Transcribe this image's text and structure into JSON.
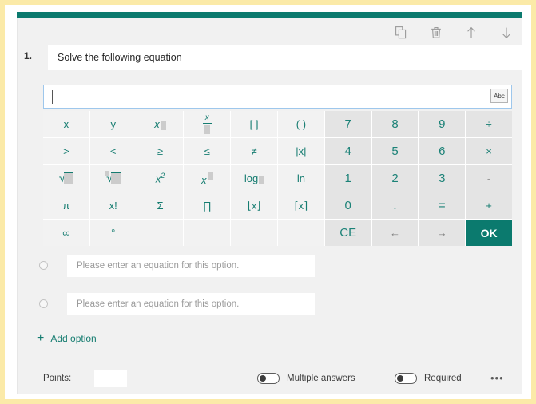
{
  "theme": {
    "accent": "#0b7a6e",
    "key_text": "#157c70",
    "outer_border": "#fbeaa8",
    "card_bg": "#f1f1f1",
    "num_key_bg": "#e4e4e4"
  },
  "toolbar": {
    "items": [
      {
        "name": "copy-icon",
        "title": "Copy question"
      },
      {
        "name": "delete-icon",
        "title": "Delete question"
      },
      {
        "name": "move-up-icon",
        "title": "Move up"
      },
      {
        "name": "move-down-icon",
        "title": "Move down"
      }
    ]
  },
  "question": {
    "number": "1.",
    "title": "Solve the following equation"
  },
  "equation_input": {
    "value": "",
    "abc_button": "Abc"
  },
  "keypad": {
    "rows": [
      [
        {
          "label": "x",
          "type": "sym"
        },
        {
          "label": "y",
          "type": "sym"
        },
        {
          "label": "x_",
          "type": "subscript"
        },
        {
          "label": "x/_",
          "type": "fraction"
        },
        {
          "label": "[ ]",
          "type": "sym"
        },
        {
          "label": "( )",
          "type": "sym"
        },
        {
          "label": "7",
          "type": "num"
        },
        {
          "label": "8",
          "type": "num"
        },
        {
          "label": "9",
          "type": "num"
        },
        {
          "label": "÷",
          "type": "op"
        }
      ],
      [
        {
          "label": ">",
          "type": "sym"
        },
        {
          "label": "<",
          "type": "sym"
        },
        {
          "label": "≥",
          "type": "sym"
        },
        {
          "label": "≤",
          "type": "sym"
        },
        {
          "label": "≠",
          "type": "sym"
        },
        {
          "label": "|x|",
          "type": "sym"
        },
        {
          "label": "4",
          "type": "num"
        },
        {
          "label": "5",
          "type": "num"
        },
        {
          "label": "6",
          "type": "num"
        },
        {
          "label": "×",
          "type": "op"
        }
      ],
      [
        {
          "label": "√",
          "type": "sqrt"
        },
        {
          "label": "ⁿ√",
          "type": "nthroot"
        },
        {
          "label": "x²",
          "type": "square"
        },
        {
          "label": "x^",
          "type": "power"
        },
        {
          "label": "log",
          "type": "log"
        },
        {
          "label": "ln",
          "type": "sym"
        },
        {
          "label": "1",
          "type": "num"
        },
        {
          "label": "2",
          "type": "num"
        },
        {
          "label": "3",
          "type": "num"
        },
        {
          "label": "-",
          "type": "op"
        }
      ],
      [
        {
          "label": "π",
          "type": "sym"
        },
        {
          "label": "x!",
          "type": "sym"
        },
        {
          "label": "Σ",
          "type": "sym"
        },
        {
          "label": "∏",
          "type": "sym"
        },
        {
          "label": "⌊x⌋",
          "type": "sym"
        },
        {
          "label": "⌈x⌉",
          "type": "sym"
        },
        {
          "label": "0",
          "type": "num"
        },
        {
          "label": ".",
          "type": "num"
        },
        {
          "label": "=",
          "type": "num"
        },
        {
          "label": "+",
          "type": "op"
        }
      ],
      [
        {
          "label": "∞",
          "type": "sym"
        },
        {
          "label": "°",
          "type": "sym"
        },
        {
          "label": "",
          "type": "blank"
        },
        {
          "label": "",
          "type": "blank"
        },
        {
          "label": "",
          "type": "blank"
        },
        {
          "label": "",
          "type": "blank"
        },
        {
          "label": "CE",
          "type": "num"
        },
        {
          "label": "←",
          "type": "arrow"
        },
        {
          "label": "→",
          "type": "arrow"
        },
        {
          "label": "OK",
          "type": "ok"
        }
      ]
    ]
  },
  "options": [
    {
      "placeholder": "Please enter an equation for this option.",
      "value": "",
      "selected": false
    },
    {
      "placeholder": "Please enter an equation for this option.",
      "value": "",
      "selected": false
    }
  ],
  "add_option": {
    "icon": "plus-icon",
    "label": "Add option"
  },
  "footer": {
    "points_label": "Points:",
    "points_value": "",
    "multiple_answers_label": "Multiple answers",
    "multiple_answers_on": false,
    "required_label": "Required",
    "required_on": false,
    "more_label": "•••"
  }
}
